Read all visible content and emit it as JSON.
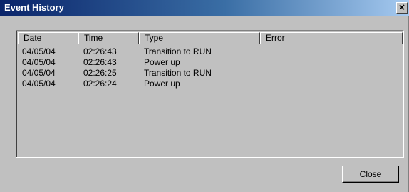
{
  "window": {
    "title": "Event History",
    "close_glyph": "×"
  },
  "table": {
    "columns": [
      "Date",
      "Time",
      "Type",
      "Error"
    ],
    "rows": [
      {
        "date": "04/05/04",
        "time": "02:26:43",
        "type": "Transition to RUN",
        "error": ""
      },
      {
        "date": "04/05/04",
        "time": "02:26:43",
        "type": "Power up",
        "error": ""
      },
      {
        "date": "04/05/04",
        "time": "02:26:25",
        "type": "Transition to RUN",
        "error": ""
      },
      {
        "date": "04/05/04",
        "time": "02:26:24",
        "type": "Power up",
        "error": ""
      }
    ]
  },
  "buttons": {
    "close_label": "Close"
  },
  "colors": {
    "title_bar_start": "#0a246a",
    "title_bar_end": "#a6caf0",
    "face": "#c0c0c0"
  }
}
